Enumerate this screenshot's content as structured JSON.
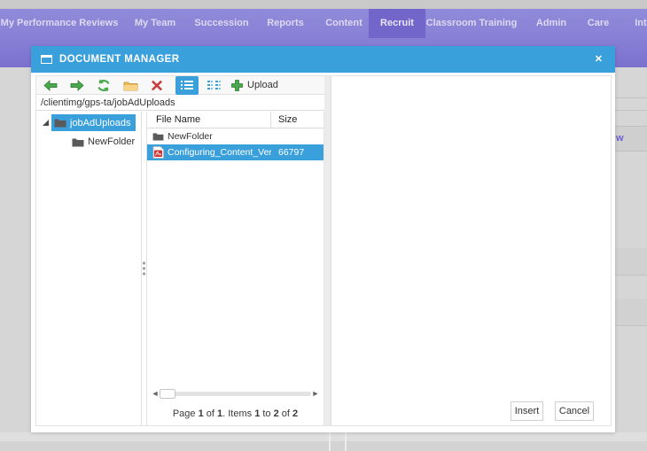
{
  "nav": {
    "items": [
      {
        "label": "My Performance Reviews",
        "active": false
      },
      {
        "label": "My Team",
        "active": false
      },
      {
        "label": "Succession",
        "active": false
      },
      {
        "label": "Reports",
        "active": false
      },
      {
        "label": "Content",
        "active": false
      },
      {
        "label": "Recruit",
        "active": true
      },
      {
        "label": "Classroom Training",
        "active": false
      },
      {
        "label": "Admin",
        "active": false
      },
      {
        "label": "Care",
        "active": false
      },
      {
        "label": "Inte",
        "active": false
      }
    ]
  },
  "background": {
    "partial_link_text": "w"
  },
  "dialog": {
    "title": "DOCUMENT MANAGER",
    "close_glyph": "✕",
    "toolbar": {
      "icons": [
        "back",
        "forward",
        "refresh",
        "new-folder",
        "delete",
        "list-view",
        "thumbnails-view",
        "upload"
      ],
      "upload_label": "Upload"
    },
    "address": "/clientimg/gps-ta/jobAdUploads",
    "tree": {
      "root": {
        "label": "jobAdUploads",
        "selected": true
      },
      "child": {
        "label": "NewFolder"
      }
    },
    "grid": {
      "columns": {
        "name": "File Name",
        "size": "Size"
      },
      "rows": [
        {
          "name": "NewFolder",
          "size": "",
          "type": "folder",
          "selected": false
        },
        {
          "name": "Configuring_Content_Vendo",
          "size": "66797",
          "type": "pdf",
          "selected": true
        }
      ],
      "scrollbar": {
        "left_arrow": "◄",
        "right_arrow": "►"
      },
      "pager_parts": [
        "Page ",
        "1",
        " of ",
        "1",
        ". Items ",
        "1",
        " to ",
        "2",
        " of ",
        "2"
      ]
    },
    "buttons": {
      "insert": "Insert",
      "cancel": "Cancel"
    }
  },
  "colors": {
    "accent_blue": "#3aa0db",
    "nav_purple": "#867fd5",
    "active_tab_purple": "#7266cb",
    "page_gray": "#d6d6d6",
    "toolbar_green": "#49a84e",
    "delete_red": "#c93b3b",
    "folder_gold": "#e8b64c",
    "pdf_red": "#d23333"
  }
}
